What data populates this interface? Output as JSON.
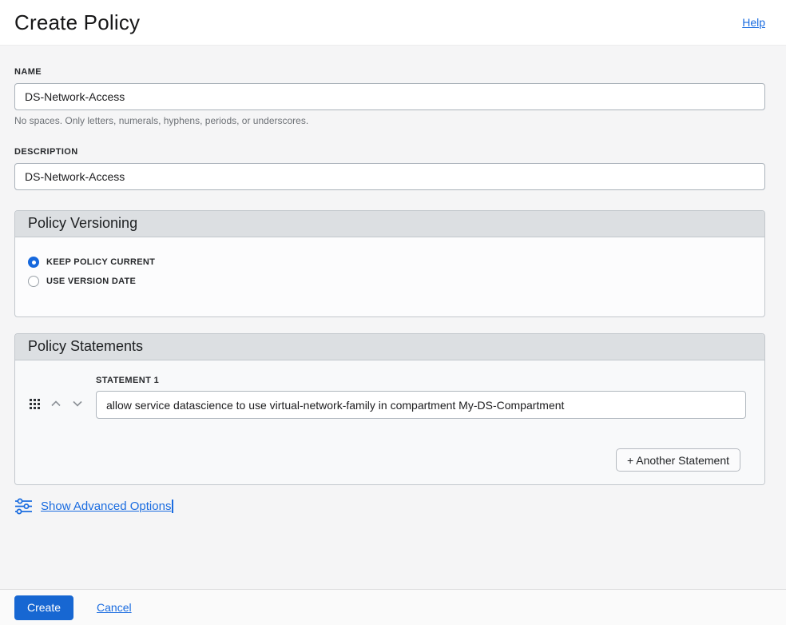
{
  "header": {
    "title": "Create Policy",
    "help_label": "Help"
  },
  "name_field": {
    "label": "NAME",
    "value": "DS-Network-Access",
    "helper": "No spaces. Only letters, numerals, hyphens, periods, or underscores."
  },
  "description_field": {
    "label": "DESCRIPTION",
    "value": "DS-Network-Access"
  },
  "policy_versioning": {
    "title": "Policy Versioning",
    "options": [
      {
        "label": "KEEP POLICY CURRENT",
        "selected": true
      },
      {
        "label": "USE VERSION DATE",
        "selected": false
      }
    ]
  },
  "policy_statements": {
    "title": "Policy Statements",
    "statement_label": "STATEMENT 1",
    "statement_value": "allow service datascience to use virtual-network-family in compartment My-DS-Compartment",
    "add_button_label": "+ Another Statement"
  },
  "advanced_options": {
    "link_label": "Show Advanced Options"
  },
  "footer": {
    "create_label": "Create",
    "cancel_label": "Cancel"
  },
  "colors": {
    "accent_blue": "#1a6ce0",
    "section_header_bg": "#dcdfe2",
    "page_bg": "#f5f5f6",
    "radio_selected": "#1668dd"
  }
}
